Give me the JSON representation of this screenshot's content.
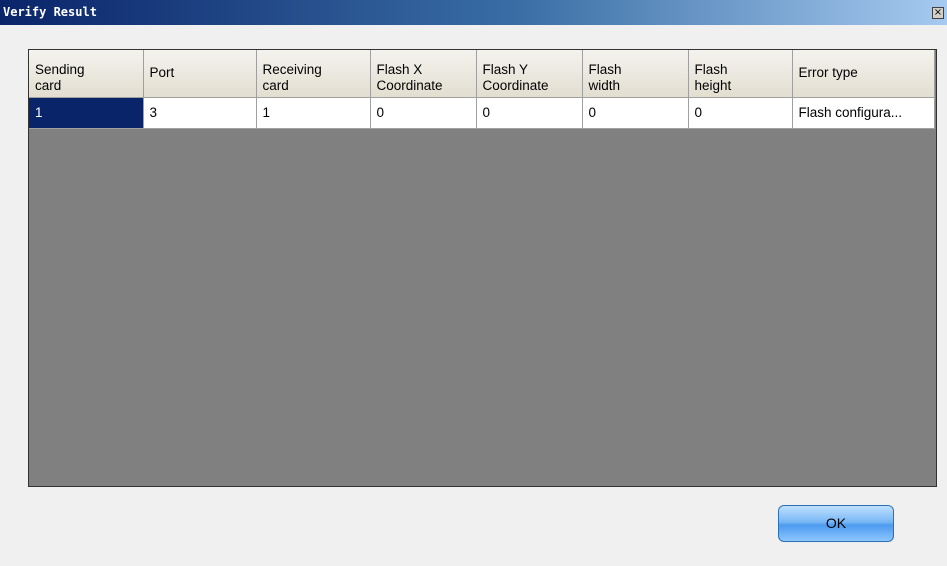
{
  "window": {
    "title": "Verify Result",
    "close_glyph": "×"
  },
  "table": {
    "columns": [
      {
        "label": "Sending\ncard",
        "line1": "Sending",
        "line2": "card"
      },
      {
        "label": "Port",
        "line1": "Port",
        "line2": ""
      },
      {
        "label": "Receiving\ncard",
        "line1": "Receiving",
        "line2": "card"
      },
      {
        "label": "Flash X\nCoordinate",
        "line1": "Flash X",
        "line2": "Coordinate"
      },
      {
        "label": "Flash Y\nCoordinate",
        "line1": "Flash Y",
        "line2": "Coordinate"
      },
      {
        "label": "Flash\nwidth",
        "line1": "Flash",
        "line2": "width"
      },
      {
        "label": "Flash\nheight",
        "line1": "Flash",
        "line2": "height"
      },
      {
        "label": "Error type",
        "line1": "Error type",
        "line2": ""
      }
    ],
    "rows": [
      {
        "cells": [
          "1",
          "3",
          "1",
          "0",
          "0",
          "0",
          "0",
          "Flash configura..."
        ]
      }
    ]
  },
  "buttons": {
    "ok_label": "OK"
  },
  "colors": {
    "title_gradient_start": "#0a246a",
    "grid_background": "#808080",
    "selected_cell": "#0a246a",
    "ok_button": "#4d9bf0"
  },
  "icons": {
    "close": "close-icon"
  }
}
